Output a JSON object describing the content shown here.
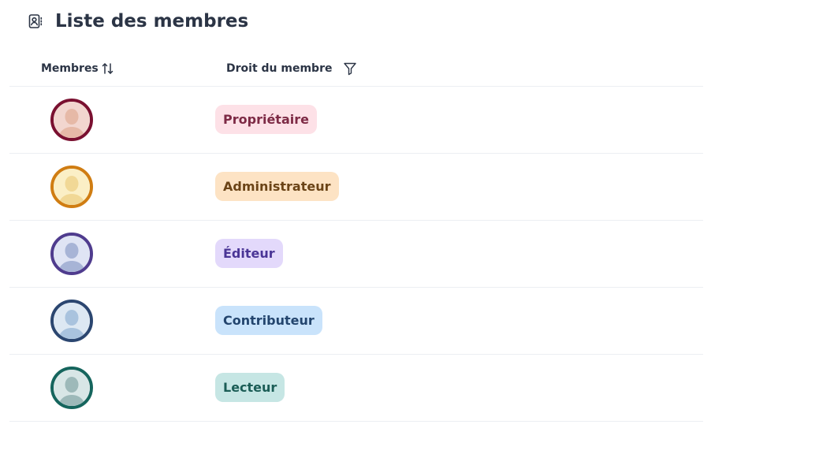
{
  "header": {
    "title": "Liste des membres",
    "icon": "contact-book-icon"
  },
  "table": {
    "columns": {
      "members": "Membres",
      "role": "Droit du membre"
    },
    "rows": [
      {
        "role": "Propriétaire",
        "avatar_ring": "#7a1030",
        "avatar_bg": "#f2d6cf",
        "avatar_fg": "#e6b9a7",
        "badge_bg": "#fde1e7",
        "badge_text": "#7d2a45"
      },
      {
        "role": "Administrateur",
        "avatar_ring": "#d07d12",
        "avatar_bg": "#fbefc6",
        "avatar_fg": "#f1d896",
        "badge_bg": "#fde3c4",
        "badge_text": "#6b4417"
      },
      {
        "role": "Éditeur",
        "avatar_ring": "#4f3c8e",
        "avatar_bg": "#dfe4f4",
        "avatar_fg": "#a7b4d6",
        "badge_bg": "#e3d9fb",
        "badge_text": "#4a3596"
      },
      {
        "role": "Contributeur",
        "avatar_ring": "#2b4670",
        "avatar_bg": "#dde8f3",
        "avatar_fg": "#a9c3de",
        "badge_bg": "#c9e3fb",
        "badge_text": "#23456e"
      },
      {
        "role": "Lecteur",
        "avatar_ring": "#15655d",
        "avatar_bg": "#d8e6e6",
        "avatar_fg": "#9db9b9",
        "badge_bg": "#c6e6e4",
        "badge_text": "#1b5d56"
      }
    ]
  }
}
